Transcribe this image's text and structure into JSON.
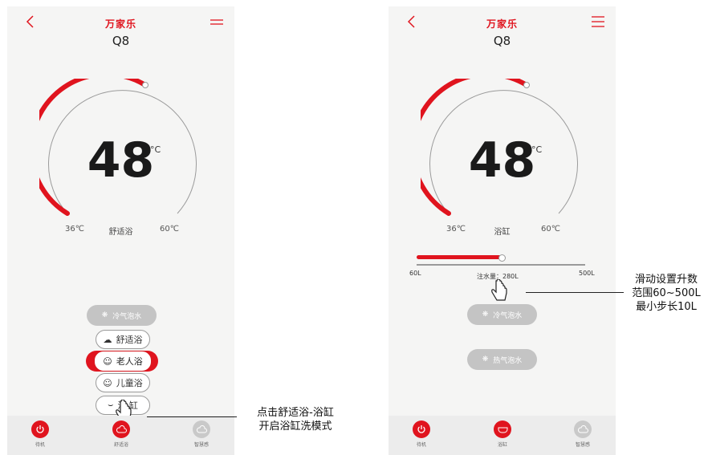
{
  "brand": "万家乐",
  "model": "Q8",
  "temperature": {
    "value": "48",
    "unit": "°C",
    "min_label": "36℃",
    "max_label": "60℃"
  },
  "screen1": {
    "mode_label": "舒适浴",
    "options": {
      "cold_bubble": "冷气泡水",
      "comfort_bath": "舒适浴",
      "elder_bath": "老人浴",
      "child_bath": "儿童浴",
      "bathtub": "浴  缸"
    },
    "bottom_nav": [
      "待机",
      "舒适浴",
      "智慧感"
    ]
  },
  "screen2": {
    "mode_label": "浴缸",
    "slider": {
      "min_label": "60L",
      "max_label": "500L",
      "value_label": "注水量：280L",
      "value": 280,
      "min": 60,
      "max": 500
    },
    "options": {
      "cold_bubble": "冷气泡水",
      "hot_bubble": "热气泡水"
    },
    "bottom_nav": [
      "待机",
      "浴缸",
      "智慧感"
    ]
  },
  "annotations": {
    "left": [
      "点击舒适浴-浴缸",
      "开启浴缸洗模式"
    ],
    "right": [
      "滑动设置升数",
      "范围60~500L",
      "最小步长10L"
    ]
  },
  "colors": {
    "accent": "#e0141e",
    "bg": "#f5f5f4",
    "gray_pill": "#c4c4c4"
  }
}
